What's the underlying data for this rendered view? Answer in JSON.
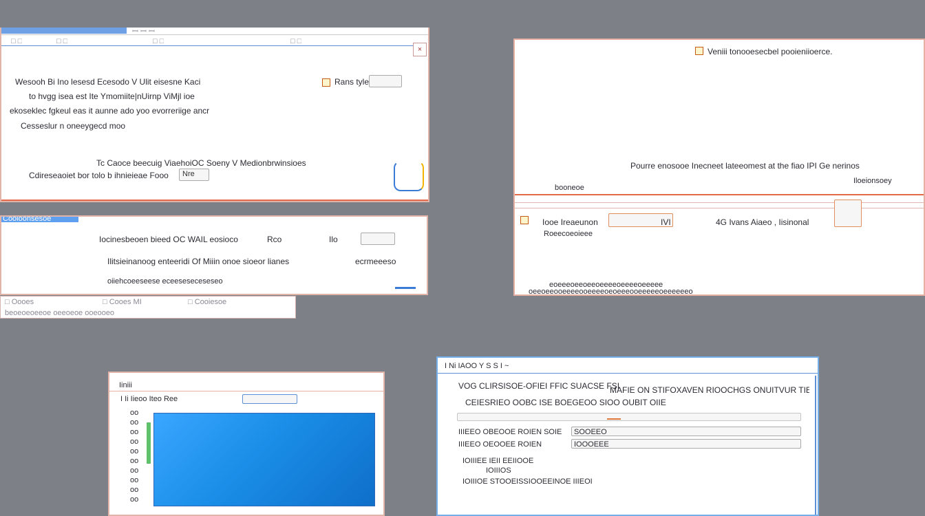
{
  "colors": {
    "desktop": "#7d8087",
    "accent_blue": "#5a8fd8",
    "accent_orange": "#e0773a"
  },
  "win1": {
    "title": "ꟷ ꟷ ꟷ",
    "menu": [
      "□ □",
      "□ □",
      "□ □",
      "□ □"
    ],
    "line1": "Wesooh Bi Ino lesesd Ecesodo V Ulit eisesne Kaci",
    "line2": "to hvgg isea est Ite Ymomiite|nUirnp ViMjl ioe",
    "line3": "ekoseklec fgkeul eas it aunne ado yoo evorreriige ancr",
    "line4": "Cesseslur n oneeygecd moo",
    "line5": "Tc Caoce beecuig ViaehoiOC Soeny V Medionbrwinsioes",
    "line6": "Cdireseaoiet bor tolo b ihnieieae Fooo",
    "side_btn": "Rans tyle",
    "btn_label": "Nre"
  },
  "win2": {
    "title": "Cooioonsesoe",
    "line1": "Iocinesbeoen bieed OC WAIL eosioco",
    "line2": "Ilitsieinanoog enteeridi Of Miiin onoe sioeor lianes",
    "line3": "ecrmeeesoe",
    "footer": "oiiehcoeeseese eceeseseceseseo",
    "btn_label": "Rco",
    "btn2_label": "Ilo"
  },
  "win3": {
    "tabs": [
      "□ Oooes",
      "□ Cooes MI",
      "□ Cooiesoe"
    ],
    "footer": "beoeoeoeeoe oeeoeoe ooeooeo"
  },
  "win4": {
    "heading": "Veniii tonooesecbel pooieniioerce.",
    "line1": "Pourre enosooe Inecneet lateeomest at the fiao IPI Ge nerinos",
    "right_note": "Iloeionsoey",
    "label1": "booneoe",
    "row_label": "Iooe Ireaeunon",
    "row_mid": "IVI",
    "row_right": "4G Ivans Aiaeo , Iisinonal",
    "sub": "Roeecoeoieee",
    "footer1": "eoeeeoeeoeeoeeeeoeeeeoeeeee",
    "footer2": "oeeoeeooeeeeooeeeeoeoeeeooeeeeeoeeeeeeo"
  },
  "win5": {
    "title": "Iiniii",
    "toolbar": "I Ii Iieoo Iteo Ree",
    "left_items": [
      "oo",
      "oo",
      "oo",
      "oo",
      "oo",
      "oo",
      "oo",
      "oo",
      "oo",
      "oo"
    ]
  },
  "win6": {
    "titlebar": "I Ni IAOO Y S S I ~",
    "line1": "VOG CLIRSISOE-OFIEI FFIC SUACSE FSI",
    "line1b": "MAFIE ON STIFOXAVEN RIOOCHGS ONUITVUR TIE",
    "line2": "CEIESRIEO OOBC ISE BOEGEOO SIOO OUBIT OIIE",
    "dropdown": "",
    "field1_label": "IIIEEO OBEOOE ROIEN SOIE",
    "field1_value": "SOOEEO",
    "field2_label": "IIIEEO OEOOEE ROIEN",
    "field2_value": "IOOOEEE",
    "item1": "IOIIIEE IEII EEIIOOE",
    "item1b": "IOIIIOS",
    "item2": "IOIIIOE STOOEISSIOOEEINOE IIIEOI"
  }
}
